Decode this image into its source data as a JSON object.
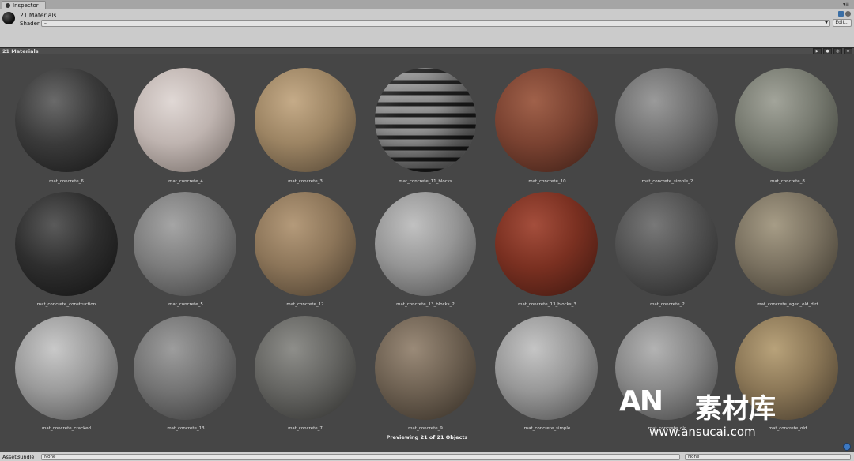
{
  "window": {
    "tab_label": "Inspector"
  },
  "header": {
    "title": "21 Materials",
    "shader_label": "Shader",
    "shader_value": "--",
    "edit_button": "Edit..."
  },
  "preview": {
    "title": "21 Materials",
    "play_label": "▶",
    "footer": "Previewing 21 of 21 Objects",
    "materials": [
      {
        "name": "mat_concrete_6"
      },
      {
        "name": "mat_concrete_4"
      },
      {
        "name": "mat_concrete_3"
      },
      {
        "name": "mat_concrete_11_blocks"
      },
      {
        "name": "mat_concrete_10"
      },
      {
        "name": "mat_concrete_simple_2"
      },
      {
        "name": "mat_concrete_8"
      },
      {
        "name": "mat_concrete_construction"
      },
      {
        "name": "mat_concrete_5"
      },
      {
        "name": "mat_concrete_12"
      },
      {
        "name": "mat_concrete_13_blocks_2"
      },
      {
        "name": "mat_concrete_13_blocks_3"
      },
      {
        "name": "mat_concrete_2"
      },
      {
        "name": "mat_concrete_aged_old_dirt"
      },
      {
        "name": "mat_concrete_cracked"
      },
      {
        "name": "mat_concrete_13"
      },
      {
        "name": "mat_concrete_7"
      },
      {
        "name": "mat_concrete_9"
      },
      {
        "name": "mat_concrete_simple"
      },
      {
        "name": "mat_concrete_old"
      },
      {
        "name": "mat_concrete_old"
      }
    ]
  },
  "watermark": {
    "logo": "AN",
    "chinese": "素材库",
    "url": "www.ansucai.com"
  },
  "assetbar": {
    "label": "AssetBundle",
    "bundle_value": "None",
    "variant_value": "None"
  },
  "colors": {
    "preview_bg": "#464646",
    "panel_bg": "#cbcbcb",
    "toolbar_bg": "#4d4d4d"
  }
}
